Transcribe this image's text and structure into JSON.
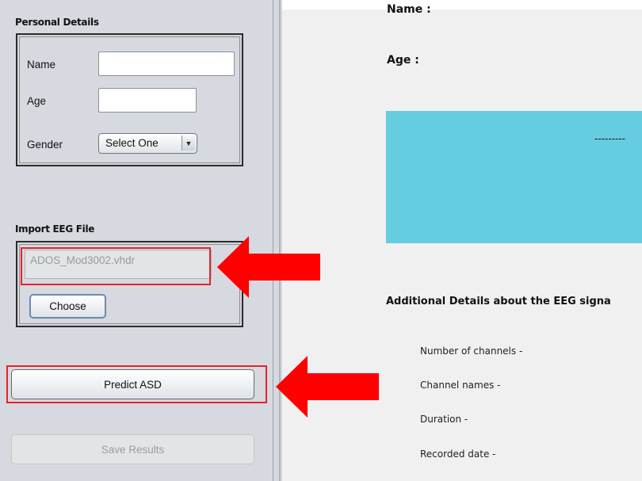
{
  "personal_details": {
    "title": "Personal Details",
    "name_label": "Name",
    "name_value": "",
    "age_label": "Age",
    "age_value": "",
    "gender_label": "Gender",
    "gender_selected": "Select One"
  },
  "import_eeg": {
    "title": "Import EEG File",
    "file_name": "ADOS_Mod3002.vhdr",
    "choose_label": "Choose"
  },
  "actions": {
    "predict_label": "Predict ASD",
    "save_label": "Save Results",
    "save_enabled": false
  },
  "right_panel": {
    "name_label": "Name :",
    "age_label": "Age :",
    "banner_text": "---------",
    "additional_title": "Additional Details about the EEG signa",
    "details": [
      "Number of channels -",
      "Channel names -",
      "Duration -",
      "Recorded date -"
    ]
  },
  "colors": {
    "highlight": "#e5232b",
    "arrow": "#ff0000",
    "banner": "#66ccdf"
  },
  "icons": {
    "combo_arrow": "chevron-down-icon",
    "annotation_arrow": "left-arrow-icon"
  }
}
